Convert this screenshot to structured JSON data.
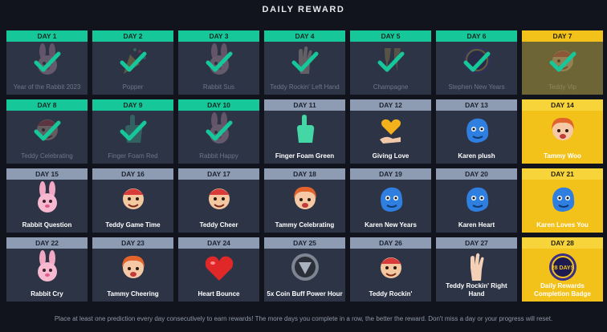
{
  "title": "DAILY REWARD",
  "footer": "Place at least one prediction every day consecutively to earn rewards! The more days you complete in a row, the better the reward. Don't miss a day or your progress will reset.",
  "colors": {
    "claimed_header": "#16c79a",
    "open_header": "#8d9bb3",
    "gold": "#f2c21b",
    "card": "#2d3446",
    "background": "#11141c"
  },
  "days": [
    {
      "day": "DAY 1",
      "label": "Year of the Rabbit 2023",
      "status": "claimed",
      "icon": "rabbit-icon"
    },
    {
      "day": "DAY 2",
      "label": "Popper",
      "status": "claimed",
      "icon": "party-popper-icon"
    },
    {
      "day": "DAY 3",
      "label": "Rabbit Sus",
      "status": "claimed",
      "icon": "rabbit-icon"
    },
    {
      "day": "DAY 4",
      "label": "Teddy Rockin' Left Hand",
      "status": "claimed",
      "icon": "hand-icon"
    },
    {
      "day": "DAY 5",
      "label": "Champagne",
      "status": "claimed",
      "icon": "champagne-icon"
    },
    {
      "day": "DAY 6",
      "label": "Stephen New Years",
      "status": "claimed",
      "icon": "badge-icon"
    },
    {
      "day": "DAY 7",
      "label": "Teddy Vip",
      "status": "claimed-gold",
      "icon": "teddy-icon"
    },
    {
      "day": "DAY 8",
      "label": "Teddy Celebrating",
      "status": "claimed",
      "icon": "teddy-icon"
    },
    {
      "day": "DAY 9",
      "label": "Finger Foam Red",
      "status": "claimed",
      "icon": "foam-finger-icon"
    },
    {
      "day": "DAY 10",
      "label": "Rabbit Happy",
      "status": "claimed",
      "icon": "rabbit-icon"
    },
    {
      "day": "DAY 11",
      "label": "Finger Foam Green",
      "status": "open",
      "icon": "foam-finger-icon"
    },
    {
      "day": "DAY 12",
      "label": "Giving Love",
      "status": "open",
      "icon": "heart-hand-icon"
    },
    {
      "day": "DAY 13",
      "label": "Karen plush",
      "status": "open",
      "icon": "karen-icon"
    },
    {
      "day": "DAY 14",
      "label": "Tammy Woo",
      "status": "gold",
      "icon": "tammy-icon"
    },
    {
      "day": "DAY 15",
      "label": "Rabbit Question",
      "status": "open",
      "icon": "rabbit-icon"
    },
    {
      "day": "DAY 16",
      "label": "Teddy Game Time",
      "status": "open",
      "icon": "teddy-icon"
    },
    {
      "day": "DAY 17",
      "label": "Teddy Cheer",
      "status": "open",
      "icon": "teddy-icon"
    },
    {
      "day": "DAY 18",
      "label": "Tammy Celebrating",
      "status": "open",
      "icon": "tammy-icon"
    },
    {
      "day": "DAY 19",
      "label": "Karen New Years",
      "status": "open",
      "icon": "karen-icon"
    },
    {
      "day": "DAY 20",
      "label": "Karen Heart",
      "status": "open",
      "icon": "karen-icon"
    },
    {
      "day": "DAY 21",
      "label": "Karen Loves You",
      "status": "gold",
      "icon": "karen-icon"
    },
    {
      "day": "DAY 22",
      "label": "Rabbit Cry",
      "status": "open",
      "icon": "rabbit-icon"
    },
    {
      "day": "DAY 23",
      "label": "Tammy Cheering",
      "status": "open",
      "icon": "tammy-icon"
    },
    {
      "day": "DAY 24",
      "label": "Heart Bounce",
      "status": "open",
      "icon": "heart-icon"
    },
    {
      "day": "DAY 25",
      "label": "5x Coin Buff Power Hour",
      "status": "open",
      "icon": "coin-icon"
    },
    {
      "day": "DAY 26",
      "label": "Teddy Rockin'",
      "status": "open",
      "icon": "teddy-icon"
    },
    {
      "day": "DAY 27",
      "label": "Teddy Rockin' Right Hand",
      "status": "open",
      "icon": "hand-icon"
    },
    {
      "day": "DAY 28",
      "label": "Daily Rewards Completion Badge",
      "status": "gold",
      "icon": "badge-icon",
      "badge_text": "28 DAYS"
    }
  ]
}
